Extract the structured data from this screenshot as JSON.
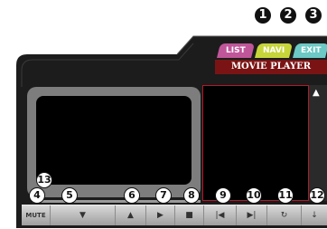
{
  "callouts_top": [
    "1",
    "2",
    "3"
  ],
  "tabs": {
    "list": "LIST",
    "navi": "NAVI",
    "exit": "EXIT"
  },
  "title": "MOVIE PLAYER",
  "callouts_bottom": [
    "4",
    "5",
    "6",
    "7",
    "8",
    "9",
    "10",
    "11",
    "12",
    "13"
  ],
  "controls": {
    "mute": "MUTE",
    "volume_down": "▼",
    "volume_up": "▲",
    "play": "▶",
    "stop": "■",
    "previous": "|◀",
    "next": "▶|",
    "repeat": "↻",
    "download": "↓"
  },
  "scroll_up": "▲",
  "colors": {
    "list_tab": "#c0569a",
    "navi_tab": "#c6d63a",
    "exit_tab": "#6cc9c5",
    "title_bar": "#7a1414",
    "list_border": "#b01b2b"
  }
}
